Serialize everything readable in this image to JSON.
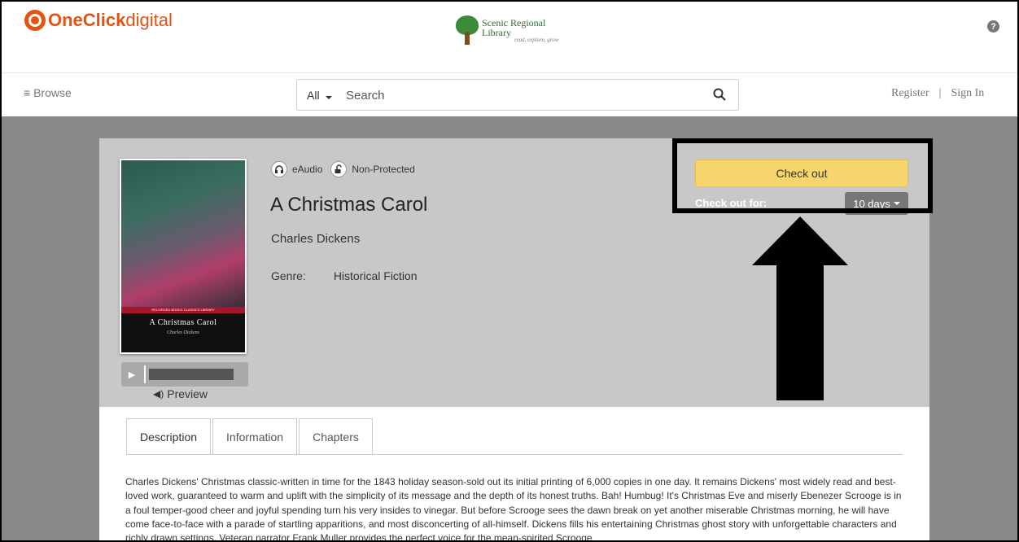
{
  "header": {
    "brand_part1": "OneClick",
    "brand_part2": "digital",
    "library_name": "Scenic Regional Library",
    "library_tagline": "read, explore, grow",
    "help_symbol": "?"
  },
  "nav": {
    "browse_label": "Browse",
    "search_scope": "All",
    "search_placeholder": "Search",
    "register_label": "Register",
    "separator": "|",
    "sign_in_label": "Sign In"
  },
  "book": {
    "format_label": "eAudio",
    "drm_label": "Non-Protected",
    "title": "A Christmas Carol",
    "author": "Charles Dickens",
    "genre_label": "Genre:",
    "genre_value": "Historical Fiction",
    "cover_series": "RECORDED BOOKS CLASSICS LIBRARY",
    "cover_title": "A Christmas Carol",
    "cover_author": "Charles Dickens",
    "preview_label": "Preview"
  },
  "checkout": {
    "button_label": "Check out",
    "for_label": "Check out for:",
    "duration": "10 days"
  },
  "tabs": [
    {
      "label": "Description"
    },
    {
      "label": "Information"
    },
    {
      "label": "Chapters"
    }
  ],
  "description": "Charles Dickens' Christmas classic-written in time for the 1843 holiday season-sold out its initial printing of 6,000 copies in one day. It remains Dickens' most widely read and best-loved work, guaranteed to warm and uplift with the simplicity of its message and the depth of its honest truths. Bah! Humbug! It's Christmas Eve and miserly Ebenezer Scrooge is in a foul temper-good cheer and joyful spending turn his very insides to vinegar. But before Scrooge sees the dawn break on yet another miserable Christmas morning, he will have come face-to-face with a parade of startling apparitions, and most disconcerting of all-himself. Dickens fills his entertaining Christmas ghost story with unforgettable characters and richly drawn settings. Veteran narrator Frank Muller provides the perfect voice for the mean-spirited Scrooge",
  "colors": {
    "brand": "#e25411",
    "checkout_button": "#f8d46c",
    "page_background": "#8a8a8a",
    "card_header": "#c8c8c8"
  },
  "icons": {
    "help": "question-circle-icon",
    "menu": "hamburger-icon",
    "search": "magnifier-icon",
    "format": "headphones-icon",
    "drm": "unlock-icon",
    "play": "play-icon",
    "speaker": "speaker-icon"
  }
}
